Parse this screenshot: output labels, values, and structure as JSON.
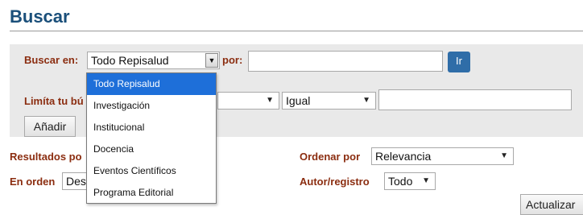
{
  "page": {
    "title": "Buscar"
  },
  "search": {
    "in_label": "Buscar en:",
    "scope_value": "Todo Repisalud",
    "por_label": "por:",
    "query_value": "",
    "go_label": "Ir"
  },
  "filter": {
    "label": "Limíta tu bú",
    "field_value": "",
    "operator_value": "Igual",
    "text_value": "",
    "add_label": "Añadir"
  },
  "results": {
    "rpp_label": "Resultados po",
    "order_by_label": "Ordenar por",
    "order_by_value": "Relevancia",
    "order_label": "En orden",
    "order_value": "Des",
    "author_label": "Autor/registro",
    "author_value": "Todo",
    "update_label": "Actualizar"
  },
  "dropdown": {
    "options": [
      {
        "label": "Todo Repisalud",
        "selected": true
      },
      {
        "label": "Investigación",
        "selected": false
      },
      {
        "label": "Institucional",
        "selected": false
      },
      {
        "label": "Docencia",
        "selected": false
      },
      {
        "label": "Eventos Científicos",
        "selected": false
      },
      {
        "label": "Programa Editorial",
        "selected": false
      }
    ]
  },
  "colors": {
    "heading": "#1a4f7a",
    "label": "#8b2d10",
    "panel": "#e9e9e9",
    "go_button": "#2f6da8",
    "selected_option": "#1e6fd9"
  }
}
